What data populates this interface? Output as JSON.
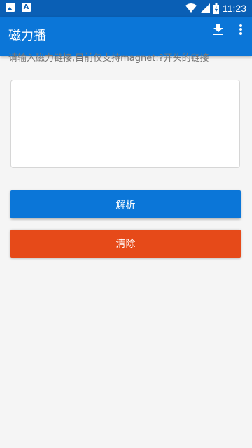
{
  "status_bar": {
    "time": "11:23",
    "icons": [
      "image-notification-icon",
      "font-notification-icon",
      "wifi-icon",
      "signal-icon",
      "battery-icon"
    ],
    "font_notif_glyph": "A"
  },
  "app_bar": {
    "title": "磁力播",
    "actions": [
      "download-icon",
      "more-vert-icon"
    ],
    "color": "#0b76d8"
  },
  "main": {
    "hint": "请输入磁力链接,目前仅支持magnet:?开头的链接",
    "input_value": "",
    "input_placeholder": "",
    "parse_button_label": "解析",
    "clear_button_label": "清除",
    "parse_color": "#0b76d8",
    "clear_color": "#e64a19"
  }
}
